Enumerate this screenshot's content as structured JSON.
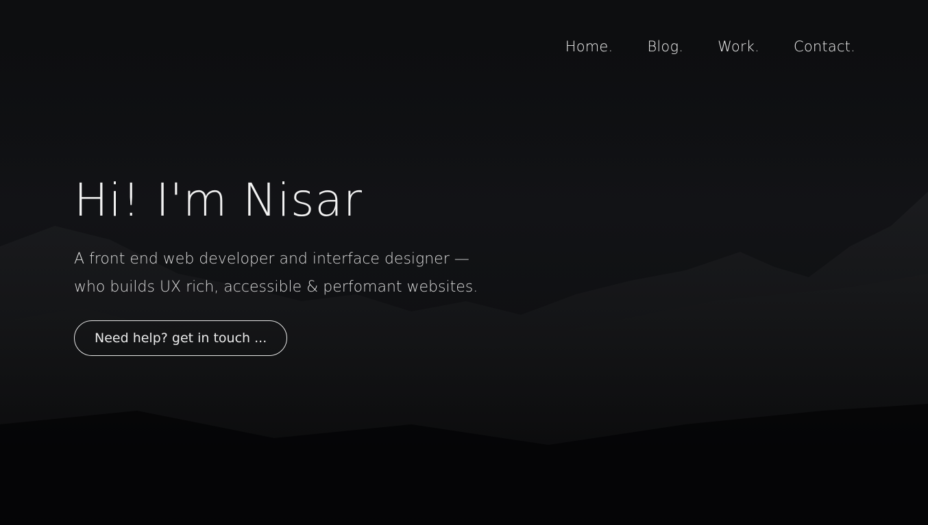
{
  "nav": {
    "items": [
      {
        "label": "Home."
      },
      {
        "label": "Blog."
      },
      {
        "label": "Work."
      },
      {
        "label": "Contact."
      }
    ]
  },
  "hero": {
    "title": "Hi! I'm Nisar",
    "subtitle_line1": "A front end web developer and interface designer —",
    "subtitle_line2": "who builds UX rich, accessible & perfomant websites.",
    "cta_label": "Need help? get in touch ..."
  },
  "colors": {
    "background": "#0b0c0e",
    "text": "#f0f0f0",
    "button_border": "#e6e6e6"
  }
}
